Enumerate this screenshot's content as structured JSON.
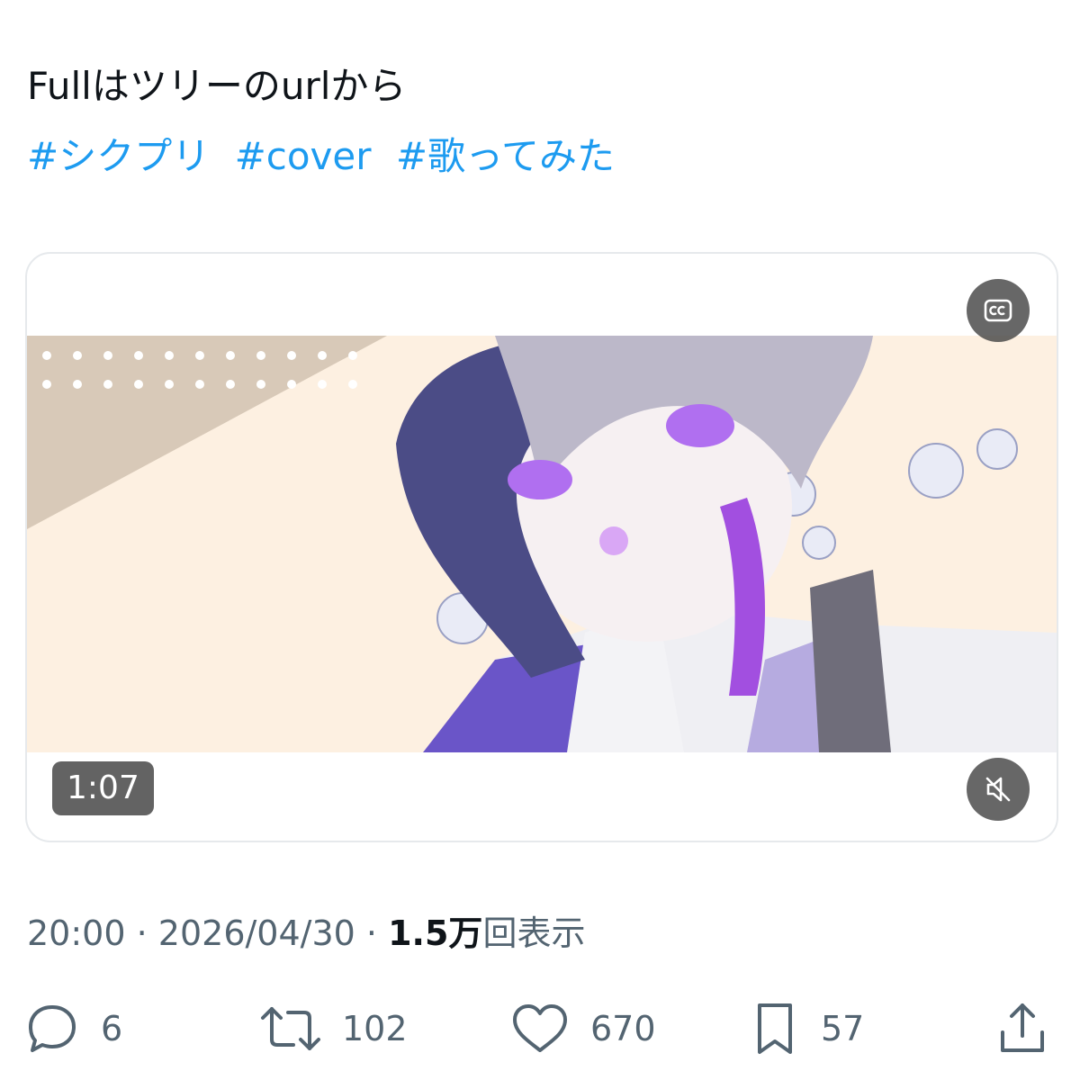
{
  "tweet": {
    "text": "Fullはツリーのurlから",
    "hashtags": [
      "#シクプリ",
      "#cover",
      "#歌ってみた"
    ]
  },
  "media": {
    "duration": "1:07",
    "cc_icon": "cc-icon",
    "mute_icon": "speaker-muted-icon"
  },
  "meta": {
    "time": "20:00",
    "separator": "·",
    "date": "2026/04/30",
    "views_count": "1.5万",
    "views_label": "回表示"
  },
  "actions": {
    "replies": "6",
    "retweets": "102",
    "likes": "670",
    "bookmarks": "57"
  },
  "colors": {
    "link": "#1d9bf0",
    "secondary_text": "#536471",
    "primary_text": "#0f1419"
  }
}
